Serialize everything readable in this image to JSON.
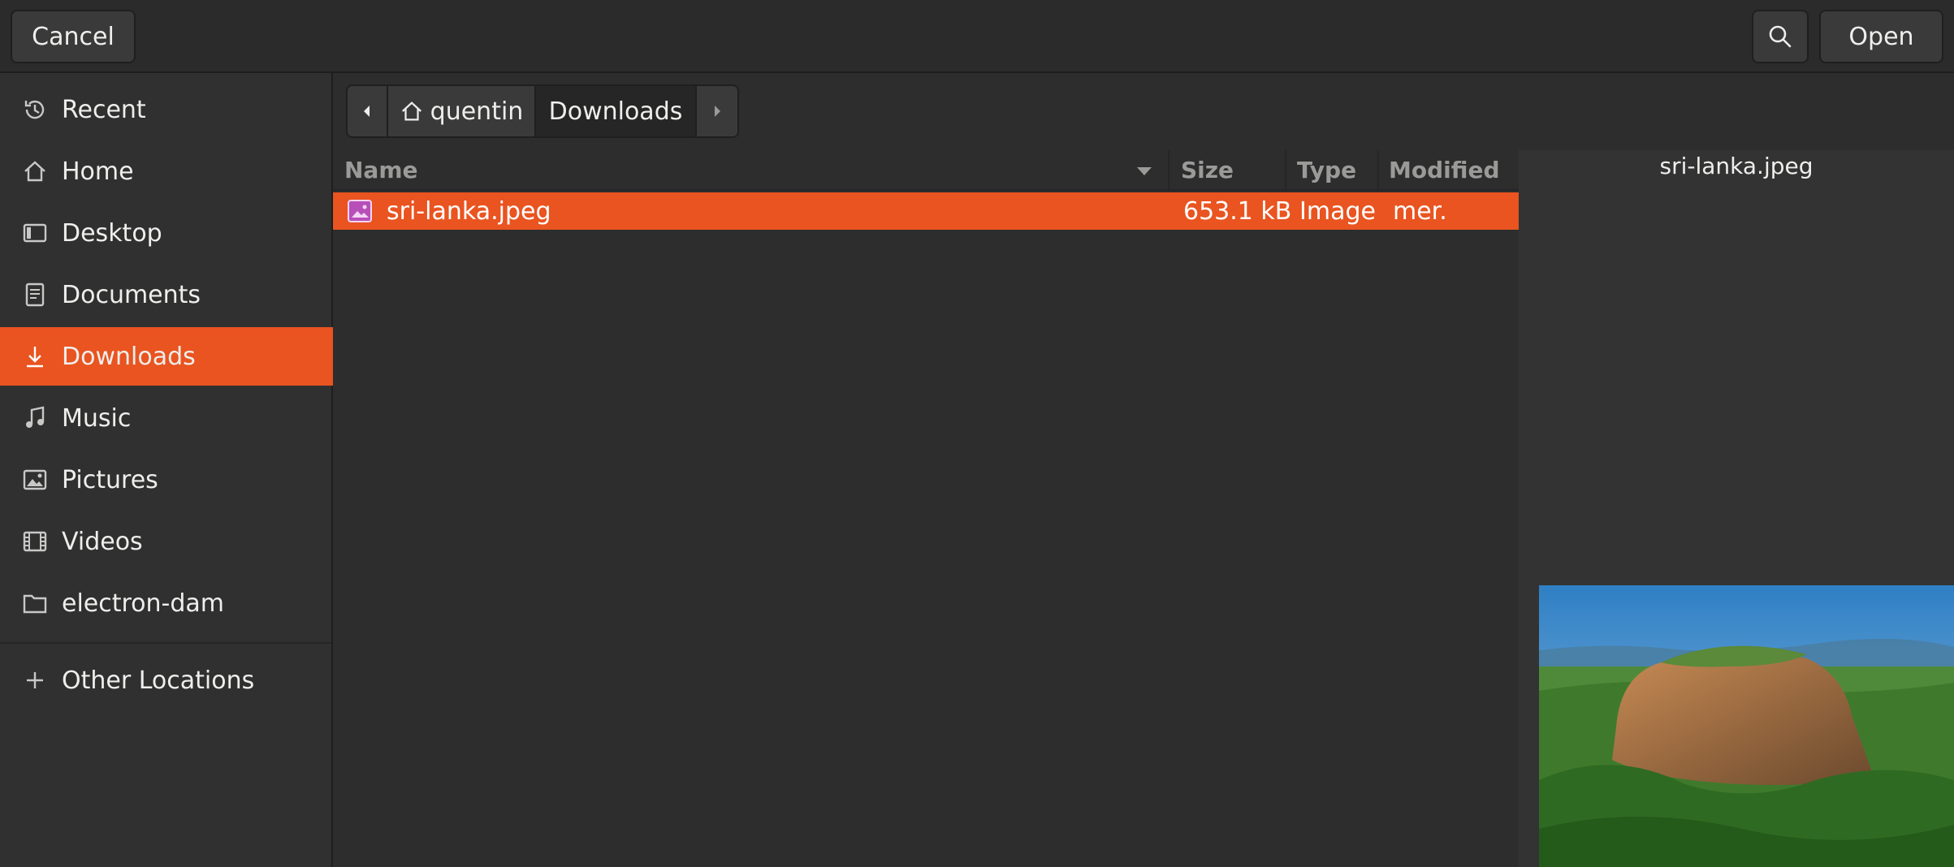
{
  "header": {
    "cancel_label": "Cancel",
    "open_label": "Open",
    "search_icon": "search-icon"
  },
  "sidebar": {
    "items": [
      {
        "label": "Recent",
        "icon": "clock-icon",
        "active": false
      },
      {
        "label": "Home",
        "icon": "home-icon",
        "active": false
      },
      {
        "label": "Desktop",
        "icon": "desktop-icon",
        "active": false
      },
      {
        "label": "Documents",
        "icon": "document-icon",
        "active": false
      },
      {
        "label": "Downloads",
        "icon": "download-icon",
        "active": true
      },
      {
        "label": "Music",
        "icon": "music-icon",
        "active": false
      },
      {
        "label": "Pictures",
        "icon": "picture-icon",
        "active": false
      },
      {
        "label": "Videos",
        "icon": "video-icon",
        "active": false
      },
      {
        "label": "electron-dam",
        "icon": "folder-icon",
        "active": false
      }
    ],
    "other_locations": "Other Locations"
  },
  "pathbar": {
    "home_label": "quentin",
    "current_label": "Downloads"
  },
  "file_list": {
    "columns": {
      "name": "Name",
      "size": "Size",
      "type": "Type",
      "modified": "Modified"
    },
    "rows": [
      {
        "name": "sri-lanka.jpeg",
        "size": "653.1 kB",
        "type": "Image",
        "modified": "mer.",
        "selected": true
      }
    ]
  },
  "preview": {
    "title": "sri-lanka.jpeg"
  },
  "colors": {
    "accent": "#e95420",
    "background": "#2d2d2d",
    "sidebar": "#303030"
  }
}
